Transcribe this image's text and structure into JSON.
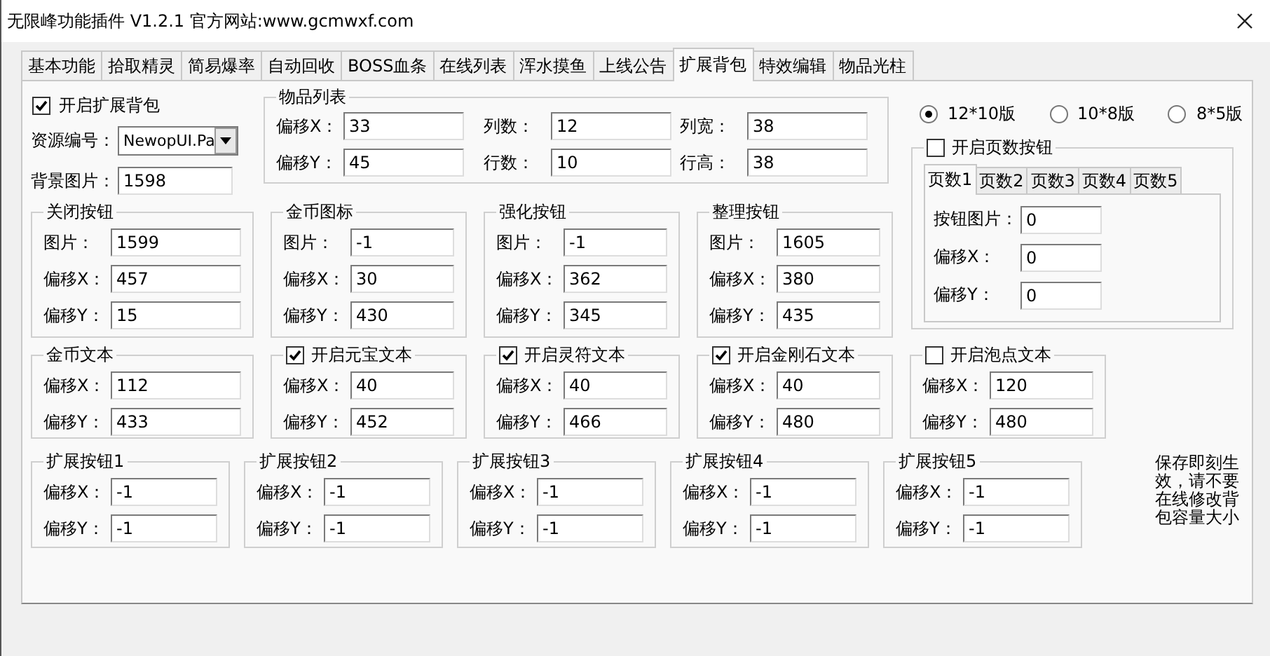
{
  "window": {
    "title": "无限峰功能插件 V1.2.1  官方网站:www.gcmwxf.com"
  },
  "tabs": [
    {
      "label": "基本功能",
      "selected": false
    },
    {
      "label": "拾取精灵",
      "selected": false
    },
    {
      "label": "简易爆率",
      "selected": false
    },
    {
      "label": "自动回收",
      "selected": false
    },
    {
      "label": "BOSS血条",
      "selected": false
    },
    {
      "label": "在线列表",
      "selected": false
    },
    {
      "label": "浑水摸鱼",
      "selected": false
    },
    {
      "label": "上线公告",
      "selected": false
    },
    {
      "label": "扩展背包",
      "selected": true
    },
    {
      "label": "特效编辑",
      "selected": false
    },
    {
      "label": "物品光柱",
      "selected": false
    }
  ],
  "expand_backpack": {
    "label": "开启扩展背包",
    "checked": true
  },
  "resource": {
    "label": "资源编号：",
    "value": "NewopUI.Pa"
  },
  "background": {
    "label": "背景图片：",
    "value": "1598"
  },
  "item_list": {
    "title": "物品列表",
    "fields": [
      {
        "label": "偏移X：",
        "value": "33"
      },
      {
        "label": "列数：",
        "value": "12"
      },
      {
        "label": "列宽：",
        "value": "38"
      },
      {
        "label": "偏移Y：",
        "value": "45"
      },
      {
        "label": "行数：",
        "value": "10"
      },
      {
        "label": "行高：",
        "value": "38"
      }
    ]
  },
  "layouts": [
    {
      "label": "12*10版",
      "selected": true
    },
    {
      "label": "10*8版",
      "selected": false
    },
    {
      "label": "8*5版",
      "selected": false
    }
  ],
  "page_buttons": {
    "label": "开启页数按钮",
    "checked": false,
    "tabs": [
      {
        "label": "页数1",
        "selected": true
      },
      {
        "label": "页数2",
        "selected": false
      },
      {
        "label": "页数3",
        "selected": false
      },
      {
        "label": "页数4",
        "selected": false
      },
      {
        "label": "页数5",
        "selected": false
      }
    ],
    "fields": [
      {
        "label": "按钮图片：",
        "value": "0"
      },
      {
        "label": "偏移X：",
        "value": "0"
      },
      {
        "label": "偏移Y：",
        "value": "0"
      }
    ]
  },
  "button_groups": [
    {
      "title": "关闭按钮",
      "fields": [
        {
          "label": "图片：",
          "value": "1599"
        },
        {
          "label": "偏移X：",
          "value": "457"
        },
        {
          "label": "偏移Y：",
          "value": "15"
        }
      ]
    },
    {
      "title": "金币图标",
      "fields": [
        {
          "label": "图片：",
          "value": "-1"
        },
        {
          "label": "偏移X：",
          "value": "30"
        },
        {
          "label": "偏移Y：",
          "value": "430"
        }
      ]
    },
    {
      "title": "强化按钮",
      "fields": [
        {
          "label": "图片：",
          "value": "-1"
        },
        {
          "label": "偏移X：",
          "value": "362"
        },
        {
          "label": "偏移Y：",
          "value": "345"
        }
      ]
    },
    {
      "title": "整理按钮",
      "fields": [
        {
          "label": "图片：",
          "value": "1605"
        },
        {
          "label": "偏移X：",
          "value": "380"
        },
        {
          "label": "偏移Y：",
          "value": "435"
        }
      ]
    }
  ],
  "text_groups": [
    {
      "kind": "plain",
      "title": "金币文本",
      "fields": [
        {
          "label": "偏移X：",
          "value": "112"
        },
        {
          "label": "偏移Y：",
          "value": "433"
        }
      ]
    },
    {
      "kind": "toggle",
      "title": "开启元宝文本",
      "checked": true,
      "fields": [
        {
          "label": "偏移X：",
          "value": "40"
        },
        {
          "label": "偏移Y：",
          "value": "452"
        }
      ]
    },
    {
      "kind": "toggle",
      "title": "开启灵符文本",
      "checked": true,
      "fields": [
        {
          "label": "偏移X：",
          "value": "40"
        },
        {
          "label": "偏移Y：",
          "value": "466"
        }
      ]
    },
    {
      "kind": "toggle",
      "title": "开启金刚石文本",
      "checked": true,
      "fields": [
        {
          "label": "偏移X：",
          "value": "40"
        },
        {
          "label": "偏移Y：",
          "value": "480"
        }
      ]
    },
    {
      "kind": "toggle",
      "title": "开启泡点文本",
      "checked": false,
      "fields": [
        {
          "label": "偏移X：",
          "value": "120"
        },
        {
          "label": "偏移Y：",
          "value": "480"
        }
      ]
    }
  ],
  "ext_buttons": [
    {
      "title": "扩展按钮1",
      "fields": [
        {
          "label": "偏移X：",
          "value": "-1"
        },
        {
          "label": "偏移Y：",
          "value": "-1"
        }
      ]
    },
    {
      "title": "扩展按钮2",
      "fields": [
        {
          "label": "偏移X：",
          "value": "-1"
        },
        {
          "label": "偏移Y：",
          "value": "-1"
        }
      ]
    },
    {
      "title": "扩展按钮3",
      "fields": [
        {
          "label": "偏移X：",
          "value": "-1"
        },
        {
          "label": "偏移Y：",
          "value": "-1"
        }
      ]
    },
    {
      "title": "扩展按钮4",
      "fields": [
        {
          "label": "偏移X：",
          "value": "-1"
        },
        {
          "label": "偏移Y：",
          "value": "-1"
        }
      ]
    },
    {
      "title": "扩展按钮5",
      "fields": [
        {
          "label": "偏移X：",
          "value": "-1"
        },
        {
          "label": "偏移Y：",
          "value": "-1"
        }
      ]
    }
  ],
  "note": "保存即刻生效，请不要在线修改背包容量大小"
}
